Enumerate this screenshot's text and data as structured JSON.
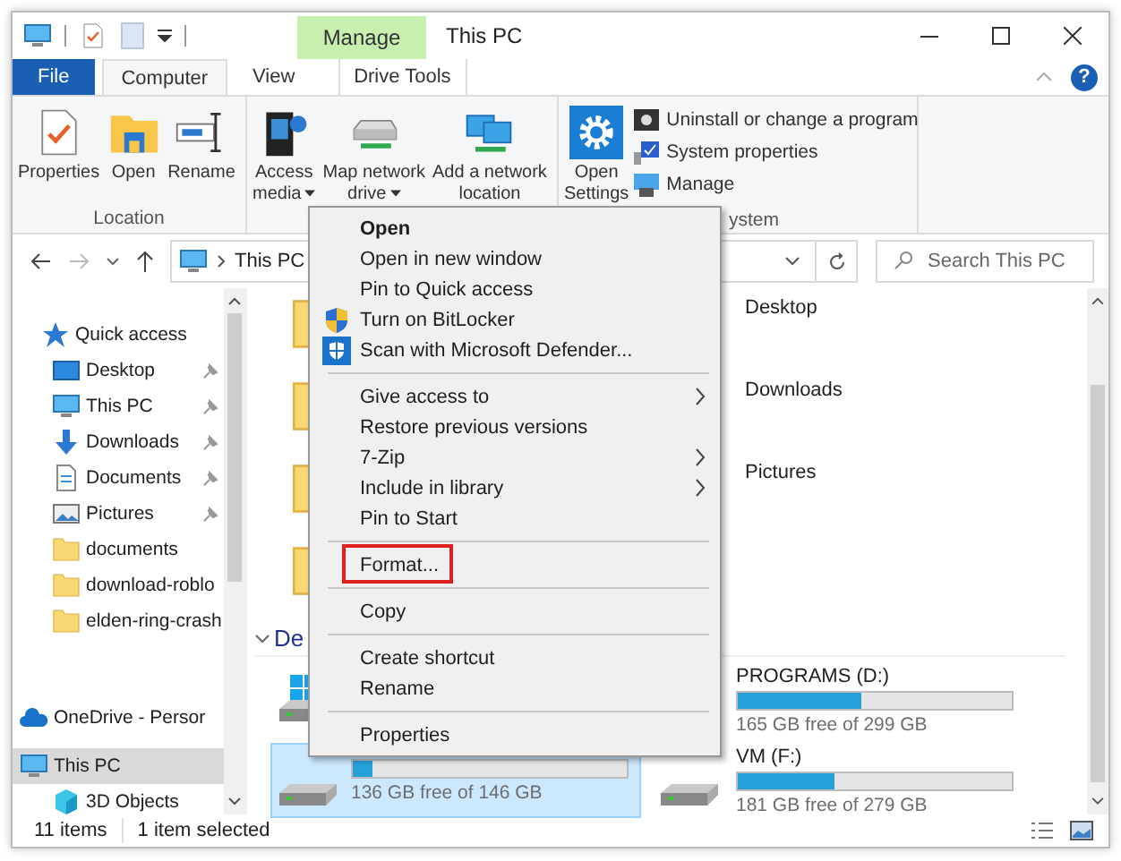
{
  "window": {
    "title": "This PC",
    "contextual_group": "Manage",
    "help": "?"
  },
  "ribbon": {
    "tabs": [
      {
        "label": "File",
        "kind": "file",
        "selected": false
      },
      {
        "label": "Computer",
        "kind": "tab",
        "selected": true
      },
      {
        "label": "View",
        "kind": "tab",
        "selected": false
      },
      {
        "label": "Drive Tools",
        "kind": "contextual",
        "selected": false
      }
    ],
    "groups": [
      {
        "label": "Location",
        "buttons": [
          {
            "label": "Properties",
            "kind": "properties"
          },
          {
            "label": "Open",
            "kind": "open"
          },
          {
            "label": "Rename",
            "kind": "rename"
          }
        ]
      },
      {
        "buttons": [
          {
            "label": "Access\nmedia",
            "kind": "media",
            "dropdown": true
          },
          {
            "label": "Map network\ndrive",
            "kind": "netdrive",
            "dropdown": true
          },
          {
            "label": "Add a network\nlocation",
            "kind": "netloc"
          }
        ]
      },
      {
        "label": "ystem",
        "buttons": [
          {
            "label": "Open\nSettings",
            "kind": "settings"
          }
        ],
        "small_buttons": [
          {
            "label": "Uninstall or change a program",
            "kind": "uninstall"
          },
          {
            "label": "System properties",
            "kind": "sysprops"
          },
          {
            "label": "Manage",
            "kind": "manage"
          }
        ]
      }
    ]
  },
  "address": {
    "path": "This PC"
  },
  "search": {
    "placeholder": "Search This PC"
  },
  "nav_pane": [
    {
      "label": "Quick access",
      "kind": "star",
      "pinned": false,
      "selected": false
    },
    {
      "label": "Desktop",
      "kind": "desktop",
      "pinned": true,
      "selected": false
    },
    {
      "label": "This PC",
      "kind": "pc",
      "pinned": true,
      "selected": false
    },
    {
      "label": "Downloads",
      "kind": "download",
      "pinned": true,
      "selected": false
    },
    {
      "label": "Documents",
      "kind": "document",
      "pinned": true,
      "selected": false
    },
    {
      "label": "Pictures",
      "kind": "pictures",
      "pinned": true,
      "selected": false
    },
    {
      "label": "documents",
      "kind": "folder",
      "pinned": false,
      "selected": false
    },
    {
      "label": "download-roblo",
      "kind": "folder",
      "pinned": false,
      "selected": false
    },
    {
      "label": "elden-ring-crash",
      "kind": "folder",
      "pinned": false,
      "selected": false
    },
    {
      "label": "OneDrive - Persor",
      "kind": "cloud",
      "pinned": false,
      "selected": false
    },
    {
      "label": "This PC",
      "kind": "pc",
      "pinned": false,
      "selected": true
    },
    {
      "label": "3D Objects",
      "kind": "cube",
      "pinned": false,
      "selected": false
    }
  ],
  "folders": [
    {
      "name": "Desktop"
    },
    {
      "name": "Downloads"
    },
    {
      "name": "Pictures"
    }
  ],
  "section": {
    "label": "De",
    "expanded": true
  },
  "drives": [
    {
      "kind": "system",
      "selected": false
    },
    {
      "kind": "local",
      "selected": false,
      "name": "PROGRAMS (D:)",
      "level": 0.45,
      "free": "165 GB free of 299 GB"
    },
    {
      "kind": "local",
      "selected": true,
      "level": 0.07,
      "free": "136 GB free of 146 GB"
    },
    {
      "kind": "local",
      "selected": false,
      "name": "VM (F:)",
      "level": 0.35,
      "free": "181 GB free of 279 GB"
    }
  ],
  "context_menu": [
    {
      "kind": "item",
      "label": "Open",
      "default": true
    },
    {
      "kind": "item",
      "label": "Open in new window",
      "default": false
    },
    {
      "kind": "item",
      "label": "Pin to Quick access",
      "default": false
    },
    {
      "kind": "bitlocker",
      "label": "Turn on BitLocker",
      "default": false
    },
    {
      "kind": "defender",
      "label": "Scan with Microsoft Defender...",
      "default": false
    },
    {
      "kind": "separator"
    },
    {
      "kind": "item",
      "label": "Give access to",
      "submenu": true
    },
    {
      "kind": "item",
      "label": "Restore previous versions"
    },
    {
      "kind": "item",
      "label": "7-Zip",
      "submenu": true
    },
    {
      "kind": "item",
      "label": "Include in library",
      "submenu": true
    },
    {
      "kind": "item",
      "label": "Pin to Start"
    },
    {
      "kind": "separator"
    },
    {
      "kind": "item",
      "label": "Format...",
      "highlighted": true
    },
    {
      "kind": "separator"
    },
    {
      "kind": "item",
      "label": "Copy"
    },
    {
      "kind": "separator"
    },
    {
      "kind": "item",
      "label": "Create shortcut"
    },
    {
      "kind": "item",
      "label": "Rename"
    },
    {
      "kind": "separator"
    },
    {
      "kind": "item",
      "label": "Properties"
    }
  ],
  "status_bar": {
    "items": "11 items",
    "selection": "1 item selected"
  }
}
